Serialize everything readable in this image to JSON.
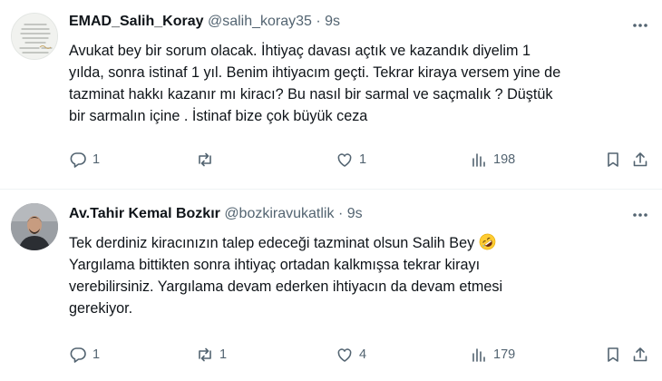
{
  "tweets": [
    {
      "author": "EMAD_Salih_Koray",
      "handle": "@salih_koray35",
      "separator": "·",
      "time": "9s",
      "avatar_text": "Ne güzel insanlar var hayatta, onlar sana yol gösterir. İyilerle olmak dileğiyle",
      "lines": [
        "Avukat bey bir sorum olacak. İhtiyaç davası açtık ve kazandık diyelim 1",
        "yılda, sonra istinaf 1 yıl. Benim ihtiyacım geçti. Tekrar kiraya versem yine de",
        "tazminat hakkı kazanır mı kiracı? Bu nasıl bir sarmal ve saçmalık ? Düştük",
        "bir sarmalın içine . İstinaf bize çok büyük ceza"
      ],
      "emoji": "",
      "replies": "1",
      "reposts": "",
      "likes": "1",
      "views": "198"
    },
    {
      "author": "Av.Tahir Kemal Bozkır",
      "handle": "@bozkiravukatlik",
      "separator": "·",
      "time": "9s",
      "lines": [
        "Tek derdiniz kiracınızın talep edeceği tazminat olsun Salih Bey",
        "Yargılama bittikten sonra ihtiyaç ortadan kalkmışsa tekrar kirayı",
        "verebilirsiniz. Yargılama devam ederken ihtiyacın da devam etmesi",
        "gerekiyor."
      ],
      "emoji": "rolling-on-the-floor-laughing-emoji",
      "replies": "1",
      "reposts": "1",
      "likes": "4",
      "views": "179"
    }
  ],
  "colors": {
    "text": "#0f1419",
    "secondary": "#536471",
    "divider": "#eff3f4",
    "emoji": "#ffcc33"
  },
  "icons": [
    "more-icon",
    "reply-icon",
    "repost-icon",
    "like-icon",
    "views-icon",
    "bookmark-icon",
    "share-icon"
  ]
}
